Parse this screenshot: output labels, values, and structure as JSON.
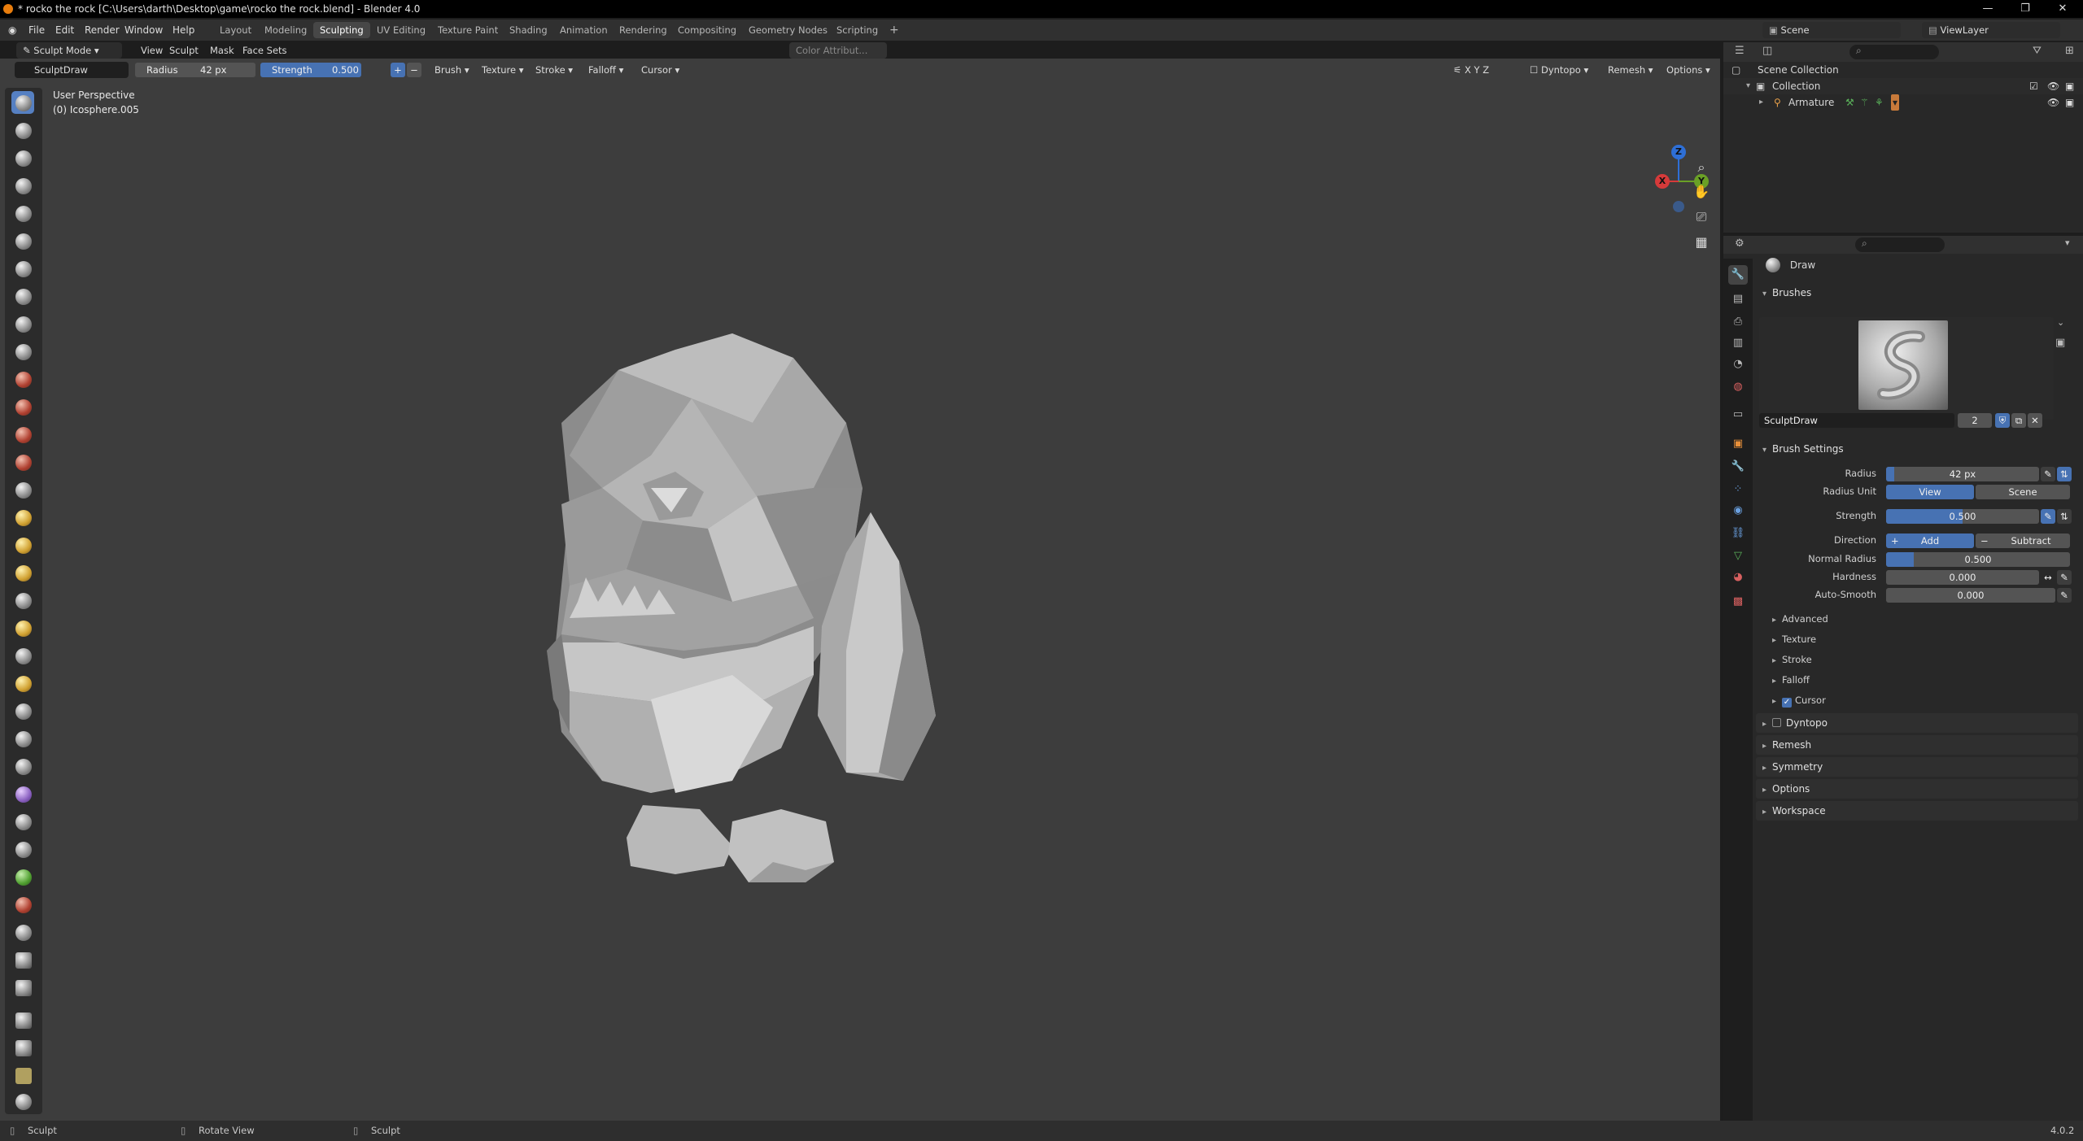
{
  "window": {
    "title": "* rocko the rock [C:\\Users\\darth\\Desktop\\game\\rocko the rock.blend] - Blender 4.0",
    "minimize": "—",
    "maximize": "❐",
    "close": "✕"
  },
  "menu": {
    "items": [
      "File",
      "Edit",
      "Render",
      "Window",
      "Help"
    ],
    "workspaces": [
      "Layout",
      "Modeling",
      "Sculpting",
      "UV Editing",
      "Texture Paint",
      "Shading",
      "Animation",
      "Rendering",
      "Compositing",
      "Geometry Nodes",
      "Scripting"
    ],
    "active_workspace": "Sculpting",
    "add_tab": "+",
    "scene": "Scene",
    "view_layer": "ViewLayer"
  },
  "viewport_header": {
    "mode": "Sculpt Mode",
    "menus": [
      "View",
      "Sculpt",
      "Mask",
      "Face Sets"
    ],
    "color_attr": "Color Attribut...",
    "brush_name": "SculptDraw",
    "radius_label": "Radius",
    "radius_value": "42 px",
    "strength_label": "Strength",
    "strength_value": "0.500",
    "popovers": [
      "Brush",
      "Texture",
      "Stroke",
      "Falloff",
      "Cursor"
    ],
    "axes": [
      "X",
      "Y",
      "Z"
    ],
    "dyntopo": "Dyntopo",
    "remesh": "Remesh",
    "options": "Options"
  },
  "viewport": {
    "perspective": "User Perspective",
    "object": "(0) Icosphere.005",
    "gizmo": {
      "z": "Z",
      "y": "Y",
      "x": "X"
    }
  },
  "outliner": {
    "root": "Scene Collection",
    "collection": "Collection",
    "armature": "Armature"
  },
  "properties": {
    "tool_name": "Draw",
    "brushes_header": "Brushes",
    "brush_name": "SculptDraw",
    "brush_users": "2",
    "brush_settings_header": "Brush Settings",
    "radius": {
      "label": "Radius",
      "value": "42 px"
    },
    "radius_unit": {
      "label": "Radius Unit",
      "view": "View",
      "scene": "Scene"
    },
    "strength": {
      "label": "Strength",
      "value": "0.500",
      "fraction": 0.5
    },
    "direction": {
      "label": "Direction",
      "add": "Add",
      "subtract": "Subtract"
    },
    "normal_radius": {
      "label": "Normal Radius",
      "value": "0.500",
      "fraction": 0.5
    },
    "hardness": {
      "label": "Hardness",
      "value": "0.000"
    },
    "auto_smooth": {
      "label": "Auto-Smooth",
      "value": "0.000"
    },
    "subpanels": [
      "Advanced",
      "Texture",
      "Stroke",
      "Falloff",
      "Cursor"
    ],
    "sections": [
      "Dyntopo",
      "Remesh",
      "Symmetry",
      "Options",
      "Workspace"
    ]
  },
  "status": {
    "left": "Sculpt",
    "middle": "Rotate View",
    "right": "Sculpt",
    "version": "4.0.2"
  },
  "colors": {
    "accent": "#4772b3",
    "active_tool": "#5680c2",
    "gizmo_z": "#2e6fd6",
    "gizmo_y": "#6aa026",
    "gizmo_x": "#d63a3a"
  }
}
